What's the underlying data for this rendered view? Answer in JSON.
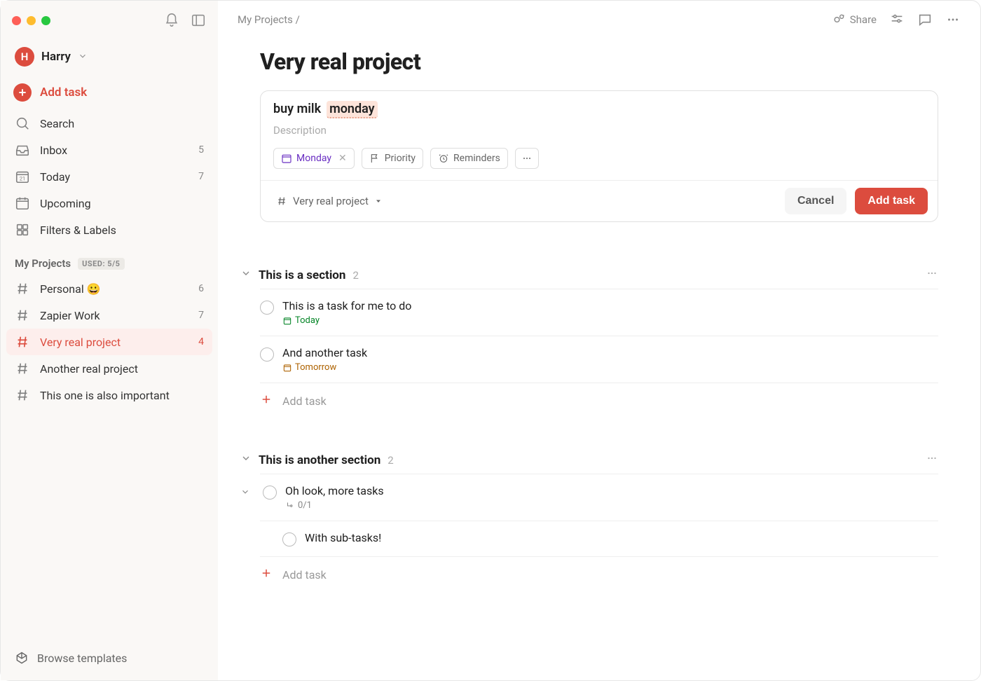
{
  "user": {
    "initial": "H",
    "name": "Harry"
  },
  "sidebar": {
    "add_task": "Add task",
    "nav": {
      "search": "Search",
      "inbox": {
        "label": "Inbox",
        "count": "5"
      },
      "today": {
        "label": "Today",
        "count": "7"
      },
      "upcoming": "Upcoming",
      "filters": "Filters & Labels"
    },
    "projects_header": "My Projects",
    "projects_badge": "USED: 5/5",
    "projects": [
      {
        "label": "Personal 😀",
        "count": "6",
        "active": false
      },
      {
        "label": "Zapier Work",
        "count": "7",
        "active": false
      },
      {
        "label": "Very real project",
        "count": "4",
        "active": true
      },
      {
        "label": "Another real project",
        "count": "",
        "active": false
      },
      {
        "label": "This one is also important",
        "count": "",
        "active": false
      }
    ],
    "browse_templates": "Browse templates"
  },
  "topbar": {
    "breadcrumb": "My Projects /",
    "share": "Share"
  },
  "page": {
    "title": "Very real project"
  },
  "composer": {
    "task_name_plain": "buy milk",
    "task_name_date": "monday",
    "description_placeholder": "Description",
    "chip_date": "Monday",
    "chip_priority": "Priority",
    "chip_reminders": "Reminders",
    "project_selector": "Very real project",
    "cancel": "Cancel",
    "submit": "Add task"
  },
  "sections": [
    {
      "title": "This is a section",
      "count": "2",
      "tasks": [
        {
          "title": "This is a task for me to do",
          "meta": "Today",
          "meta_class": "green",
          "expandable": false
        },
        {
          "title": "And another task",
          "meta": "Tomorrow",
          "meta_class": "orange",
          "expandable": false
        }
      ],
      "add_task": "Add task"
    },
    {
      "title": "This is another section",
      "count": "2",
      "tasks": [
        {
          "title": "Oh look, more tasks",
          "meta": "0/1",
          "meta_class": "gray",
          "expandable": true,
          "meta_icon": "subtask"
        },
        {
          "title": "With sub-tasks!",
          "meta": "",
          "meta_class": "",
          "sub": true
        }
      ],
      "add_task": "Add task"
    }
  ]
}
